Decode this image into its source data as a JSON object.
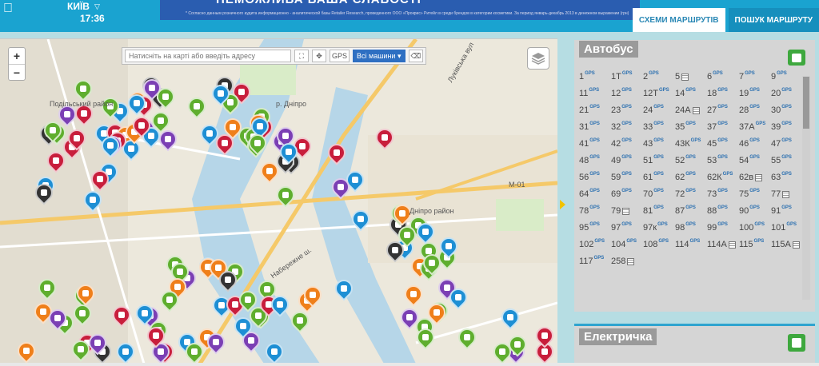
{
  "header": {
    "city": "КИЇВ",
    "time": "17:36",
    "banner_title": "НЕМОЖЛИВА ВАША СЛАБОСТІ",
    "banner_note": "* Согласно данным розничного аудита информационно - аналитической базы Retailer Research, проведенного ООО «Прокрис» Ритейл в среди брендов в категории косметики. За период январь-декабрь 2013 в денежном выражении (грн)",
    "tabs": [
      {
        "label": "СХЕМИ МАРШРУТІВ",
        "active": true
      },
      {
        "label": "ПОШУК МАРШРУТУ",
        "active": false
      }
    ]
  },
  "map": {
    "zoom_in": "+",
    "zoom_out": "−",
    "search_placeholder": "Натисніть на карті або введіть адресу",
    "gps_label": "GPS",
    "vehicles_label": "Всі машини",
    "labels": {
      "district_podil": "Подільський район",
      "road_m01": "М-01",
      "street_naberezh": "Набережне ш.",
      "dnipro_district": "Дніпро район",
      "river": "р. Дніпро",
      "luk_street": "Луківська вул"
    },
    "pin_colors": {
      "green": "#5fae2e",
      "red": "#c81e3c",
      "blue": "#1e8fd4",
      "orange": "#ef7f1a",
      "purple": "#7b3fb4",
      "black": "#333333"
    }
  },
  "panel": {
    "title": "Автобус",
    "gps_tag": "GPS",
    "routes": [
      {
        "num": "1",
        "type": "gps"
      },
      {
        "num": "1Т",
        "type": "gps"
      },
      {
        "num": "2",
        "type": "gps"
      },
      {
        "num": "5",
        "type": "sched"
      },
      {
        "num": "6",
        "type": "gps"
      },
      {
        "num": "7",
        "type": "gps"
      },
      {
        "num": "9",
        "type": "gps"
      },
      {
        "num": "11",
        "type": "gps"
      },
      {
        "num": "12",
        "type": "gps"
      },
      {
        "num": "12Т",
        "type": "gps"
      },
      {
        "num": "14",
        "type": "gps"
      },
      {
        "num": "18",
        "type": "gps"
      },
      {
        "num": "19",
        "type": "gps"
      },
      {
        "num": "20",
        "type": "gps"
      },
      {
        "num": "21",
        "type": "gps"
      },
      {
        "num": "23",
        "type": "gps"
      },
      {
        "num": "24",
        "type": "gps"
      },
      {
        "num": "24А",
        "type": "sched"
      },
      {
        "num": "27",
        "type": "gps"
      },
      {
        "num": "28",
        "type": "gps"
      },
      {
        "num": "30",
        "type": "gps"
      },
      {
        "num": "31",
        "type": "gps"
      },
      {
        "num": "32",
        "type": "gps"
      },
      {
        "num": "33",
        "type": "gps"
      },
      {
        "num": "35",
        "type": "gps"
      },
      {
        "num": "37",
        "type": "gps"
      },
      {
        "num": "37А",
        "type": "gps"
      },
      {
        "num": "39",
        "type": "gps"
      },
      {
        "num": "41",
        "type": "gps"
      },
      {
        "num": "42",
        "type": "gps"
      },
      {
        "num": "43",
        "type": "gps"
      },
      {
        "num": "43К",
        "type": "gps"
      },
      {
        "num": "45",
        "type": "gps"
      },
      {
        "num": "46",
        "type": "gps"
      },
      {
        "num": "47",
        "type": "gps"
      },
      {
        "num": "48",
        "type": "gps"
      },
      {
        "num": "49",
        "type": "gps"
      },
      {
        "num": "51",
        "type": "gps"
      },
      {
        "num": "52",
        "type": "gps"
      },
      {
        "num": "53",
        "type": "gps"
      },
      {
        "num": "54",
        "type": "gps"
      },
      {
        "num": "55",
        "type": "gps"
      },
      {
        "num": "56",
        "type": "gps"
      },
      {
        "num": "59",
        "type": "gps"
      },
      {
        "num": "61",
        "type": "gps"
      },
      {
        "num": "62",
        "type": "gps"
      },
      {
        "num": "62К",
        "type": "gps"
      },
      {
        "num": "62в",
        "type": "sched"
      },
      {
        "num": "63",
        "type": "gps"
      },
      {
        "num": "64",
        "type": "gps"
      },
      {
        "num": "69",
        "type": "gps"
      },
      {
        "num": "70",
        "type": "gps"
      },
      {
        "num": "72",
        "type": "gps"
      },
      {
        "num": "73",
        "type": "gps"
      },
      {
        "num": "75",
        "type": "gps"
      },
      {
        "num": "77",
        "type": "sched"
      },
      {
        "num": "78",
        "type": "gps"
      },
      {
        "num": "79",
        "type": "sched"
      },
      {
        "num": "81",
        "type": "gps"
      },
      {
        "num": "87",
        "type": "gps"
      },
      {
        "num": "88",
        "type": "gps"
      },
      {
        "num": "90",
        "type": "gps"
      },
      {
        "num": "91",
        "type": "gps"
      },
      {
        "num": "95",
        "type": "gps"
      },
      {
        "num": "97",
        "type": "gps"
      },
      {
        "num": "97к",
        "type": "gps"
      },
      {
        "num": "98",
        "type": "gps"
      },
      {
        "num": "99",
        "type": "gps"
      },
      {
        "num": "100",
        "type": "gps"
      },
      {
        "num": "101",
        "type": "gps"
      },
      {
        "num": "102",
        "type": "gps"
      },
      {
        "num": "104",
        "type": "gps"
      },
      {
        "num": "108",
        "type": "gps"
      },
      {
        "num": "114",
        "type": "gps"
      },
      {
        "num": "114А",
        "type": "sched"
      },
      {
        "num": "115",
        "type": "gps"
      },
      {
        "num": "115А",
        "type": "sched"
      },
      {
        "num": "117",
        "type": "gps"
      },
      {
        "num": "258",
        "type": "sched"
      }
    ]
  },
  "panel2": {
    "title": "Електричка"
  }
}
